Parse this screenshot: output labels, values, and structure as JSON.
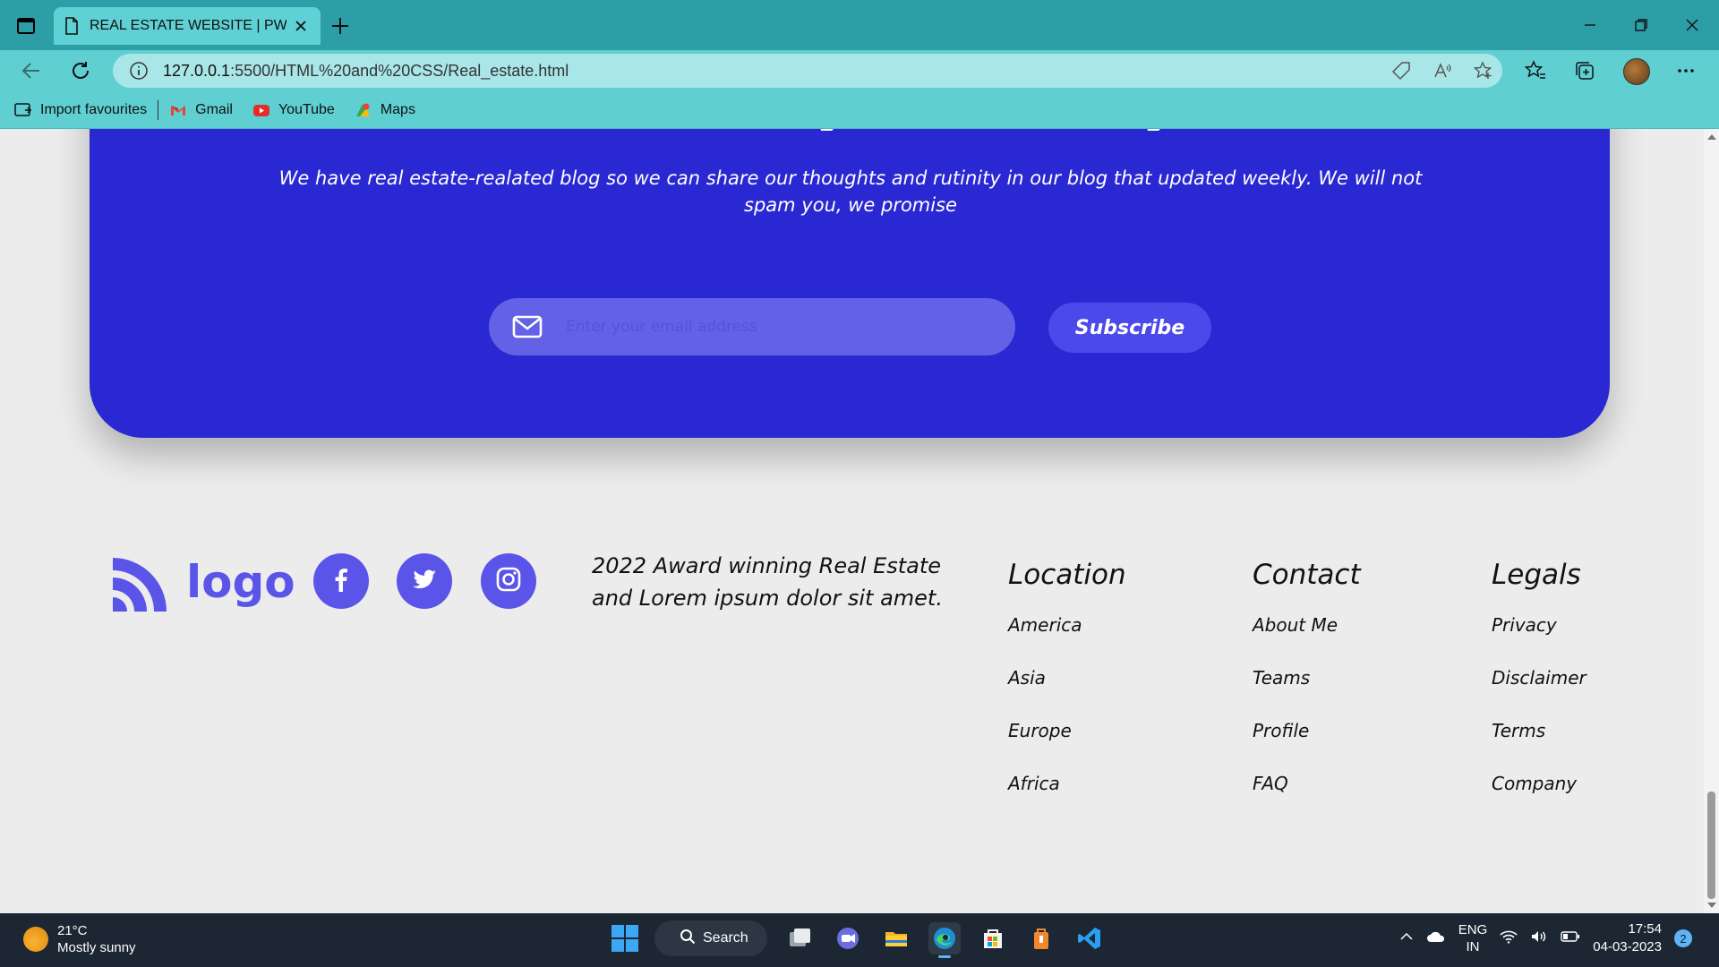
{
  "browser": {
    "tab_title": "REAL ESTATE WEBSITE | PW Assi",
    "url_host": "127.0.0.1",
    "url_path": ":5500/HTML%20and%20CSS/Real_estate.html",
    "bookmarks": [
      {
        "label": "Import favourites",
        "icon": "import-icon"
      },
      {
        "label": "Gmail",
        "icon": "gmail-icon"
      },
      {
        "label": "YouTube",
        "icon": "youtube-icon"
      },
      {
        "label": "Maps",
        "icon": "maps-icon"
      }
    ]
  },
  "newsletter": {
    "text": "We have real estate-realated blog so we can share our thoughts and rutinity in our blog that updated weekly. We will not spam you, we promise",
    "email_placeholder": "Enter your email address",
    "subscribe_label": "Subscribe",
    "bg_color": "#2a28d2"
  },
  "footer": {
    "logo_text": "logo",
    "award_text": "2022 Award winning Real Estate and Lorem ipsum dolor sit amet.",
    "social": [
      "facebook-icon",
      "twitter-icon",
      "instagram-icon"
    ],
    "accent_color": "#5a55e8",
    "columns": [
      {
        "title": "Location",
        "links": [
          "America",
          "Asia",
          "Europe",
          "Africa"
        ]
      },
      {
        "title": "Contact",
        "links": [
          "About Me",
          "Teams",
          "Profile",
          "FAQ"
        ]
      },
      {
        "title": "Legals",
        "links": [
          "Privacy",
          "Disclaimer",
          "Terms",
          "Company"
        ]
      }
    ]
  },
  "taskbar": {
    "temperature": "21°C",
    "weather": "Mostly sunny",
    "search_label": "Search",
    "lang_line1": "ENG",
    "lang_line2": "IN",
    "time": "17:54",
    "date": "04-03-2023",
    "notification_count": "2"
  }
}
